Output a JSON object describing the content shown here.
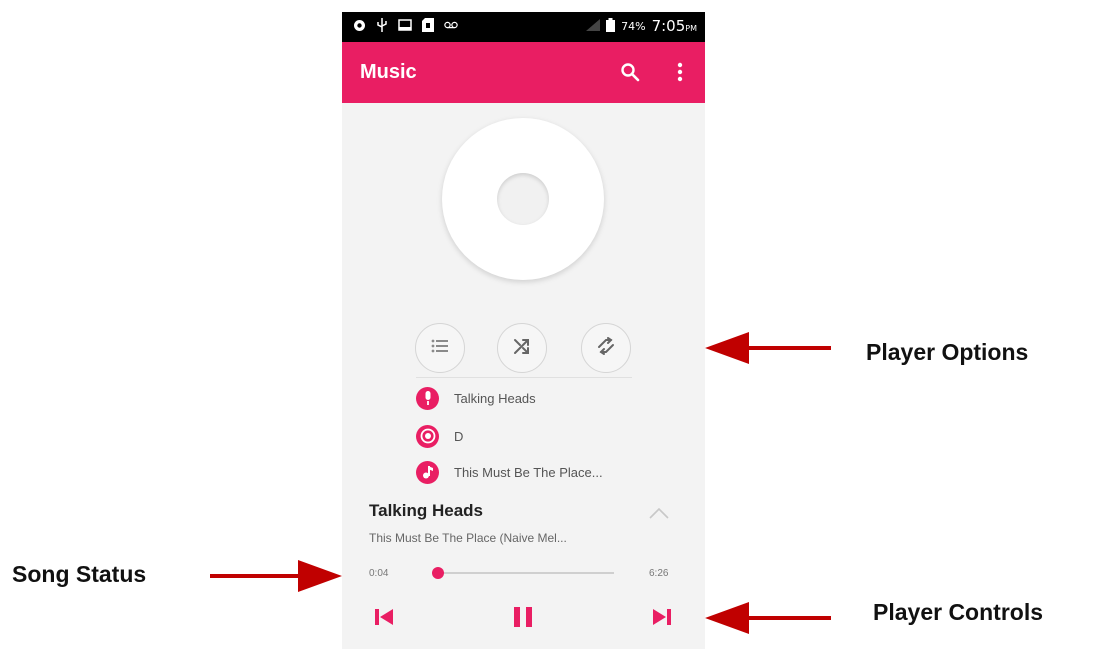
{
  "status_bar": {
    "battery": "74%",
    "time": "7:05",
    "time_suffix": "PM",
    "icons": [
      "settings-icon",
      "usb-icon",
      "screenshot-icon",
      "sd-card-icon",
      "voicemail-icon",
      "signal-icon",
      "battery-icon"
    ]
  },
  "app_bar": {
    "title": "Music",
    "icons": [
      "search-icon",
      "more-vert-icon"
    ]
  },
  "player_options": [
    {
      "icon": "playlist-icon"
    },
    {
      "icon": "shuffle-icon"
    },
    {
      "icon": "repeat-icon"
    }
  ],
  "track_info": {
    "artist": "Talking Heads",
    "album": "D",
    "song": "This Must Be The Place..."
  },
  "now_playing": {
    "title": "Talking Heads",
    "subtitle": "This Must Be The Place (Naive Mel..."
  },
  "progress": {
    "elapsed": "0:04",
    "duration": "6:26",
    "fraction": 0.01
  },
  "controls": [
    "previous-icon",
    "pause-icon",
    "next-icon"
  ],
  "annotations": {
    "player_options": "Player Options",
    "song_status": "Song Status",
    "player_controls": "Player Controls"
  },
  "colors": {
    "accent": "#e91e63",
    "arrow": "#c00000"
  }
}
